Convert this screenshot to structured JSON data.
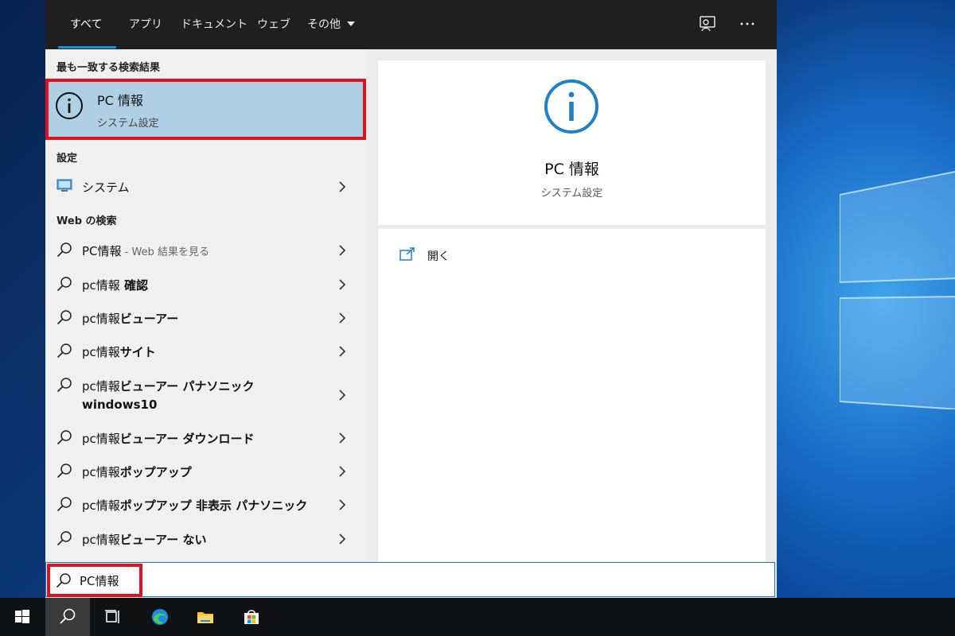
{
  "tabs": [
    {
      "label": "すべて",
      "active": true
    },
    {
      "label": "アプリ"
    },
    {
      "label": "ドキュメント"
    },
    {
      "label": "ウェブ"
    },
    {
      "label": "その他"
    }
  ],
  "tabbar_icons": [
    "feedback-icon",
    "more-options-icon"
  ],
  "best_match": {
    "section_title": "最も一致する検索結果",
    "title": "PC 情報",
    "subtitle": "システム設定",
    "icon": "info-circle-icon"
  },
  "settings": {
    "section_title": "設定",
    "items": [
      {
        "label": "システム",
        "icon": "monitor-icon"
      }
    ]
  },
  "web": {
    "section_title": "Web の検索",
    "items": [
      {
        "prefix": "PC情報",
        "bold": "",
        "hint": " - Web 結果を見る"
      },
      {
        "prefix": "pc情報",
        "bold": " 確認",
        "hint": ""
      },
      {
        "prefix": "pc情報",
        "bold": "ビューアー",
        "hint": ""
      },
      {
        "prefix": "pc情報",
        "bold": "サイト",
        "hint": ""
      },
      {
        "prefix": "pc情報",
        "bold": "ビューアー パナソニック",
        "bold2": "windows10",
        "hint": ""
      },
      {
        "prefix": "pc情報",
        "bold": "ビューアー ダウンロード",
        "hint": ""
      },
      {
        "prefix": "pc情報",
        "bold": "ポップアップ",
        "hint": ""
      },
      {
        "prefix": "pc情報",
        "bold": "ポップアップ 非表示 パナソニック",
        "hint": ""
      },
      {
        "prefix": "pc情報",
        "bold": "ビューアー ない",
        "hint": ""
      }
    ]
  },
  "preview": {
    "title": "PC 情報",
    "subtitle": "システム設定",
    "actions": [
      {
        "label": "開く",
        "icon": "open-icon"
      }
    ]
  },
  "search": {
    "value": "PC情報",
    "icon": "search-icon"
  },
  "taskbar": [
    "windows-start-icon",
    "search-icon",
    "task-view-icon",
    "edge-browser-icon",
    "file-explorer-icon",
    "microsoft-store-icon"
  ],
  "colors": {
    "accent": "#1f8ad8",
    "highlight_border": "#e0101e",
    "best_match_bg": "#aecfe4",
    "tabbar_bg": "#1f1f1f",
    "taskbar_bg": "#111214"
  }
}
